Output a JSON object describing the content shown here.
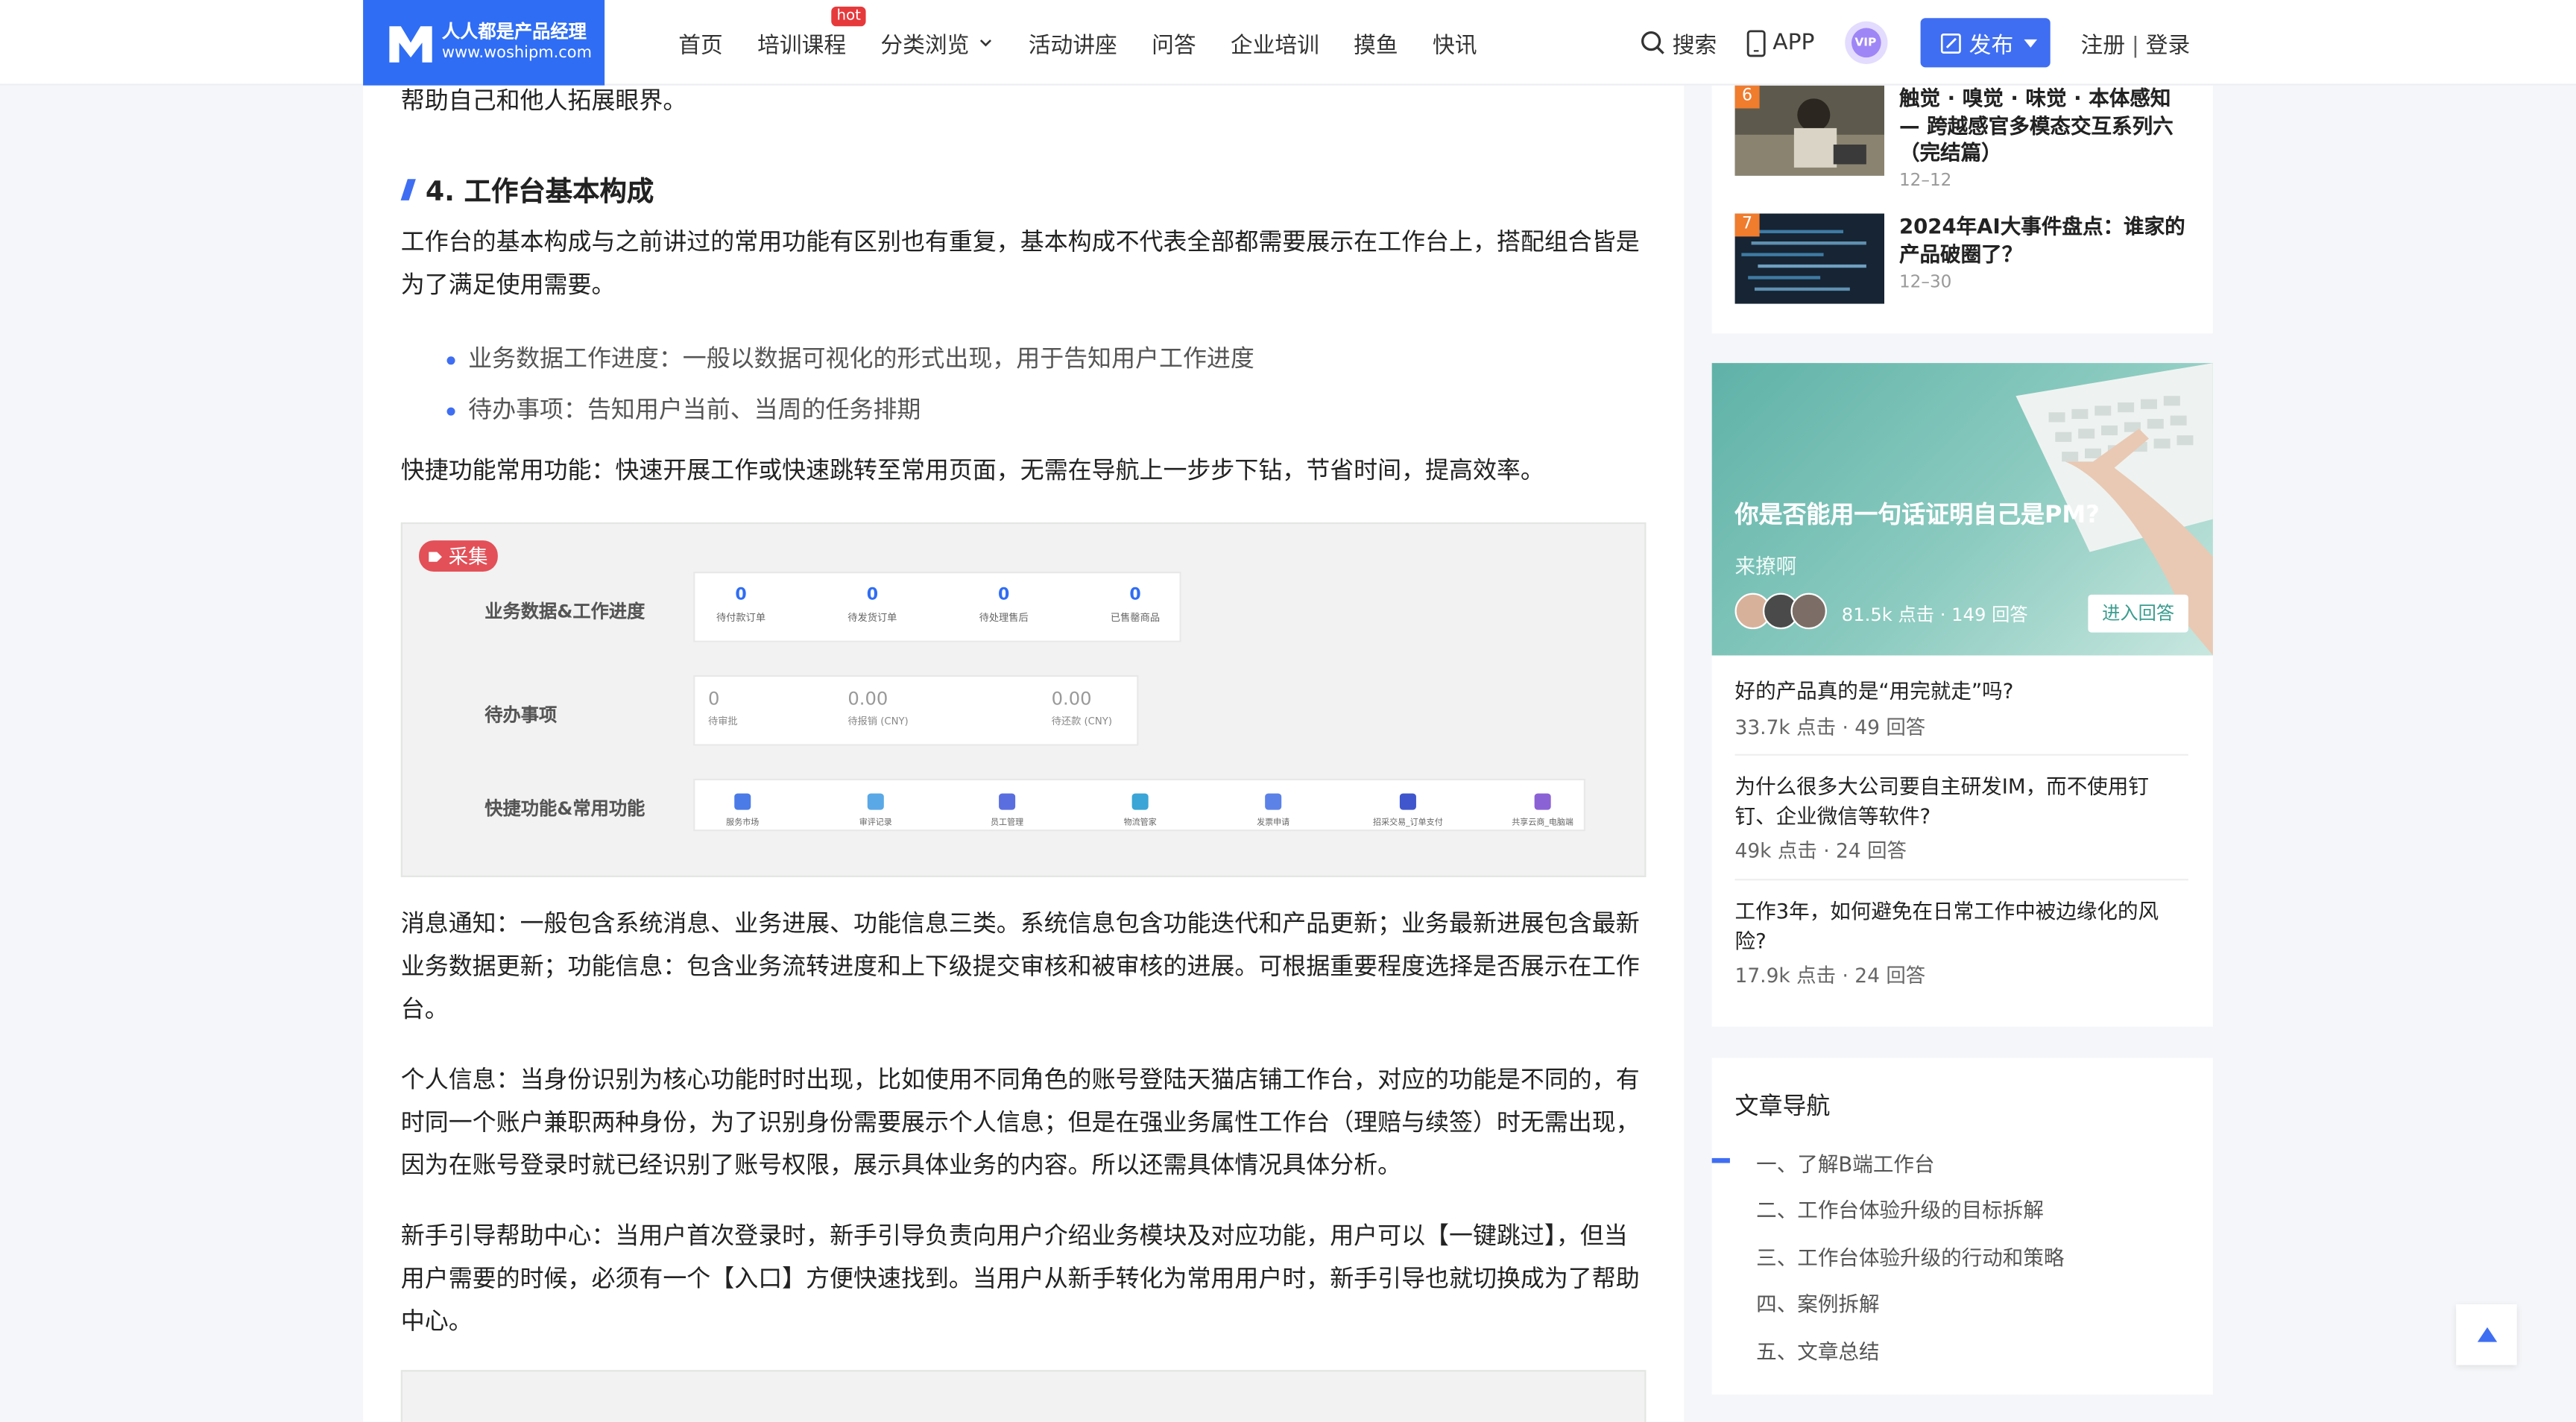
{
  "logo": {
    "line1": "人人都是产品经理",
    "line2": "www.woshipm.com"
  },
  "nav": {
    "items": [
      "首页",
      "培训课程",
      "分类浏览",
      "活动讲座",
      "问答",
      "企业培训",
      "摸鱼",
      "快讯"
    ],
    "hot_badge": "hot"
  },
  "header": {
    "search": "搜索",
    "app": "APP",
    "vip": "VIP",
    "publish": "发布",
    "register": "注册",
    "separator": "|",
    "login": "登录"
  },
  "article": {
    "p_top": "帮助自己和他人拓展眼界。",
    "section_title": "4. 工作台基本构成",
    "p1": "工作台的基本构成与之前讲过的常用功能有区别也有重复，基本构成不代表全部都需要展示在工作台上，搭配组合皆是为了满足使用需要。",
    "bullets": [
      "业务数据工作进度：一般以数据可视化的形式出现，用于告知用户工作进度",
      "待办事项：告知用户当前、当周的任务排期"
    ],
    "p2": "快捷功能常用功能：快速开展工作或快速跳转至常用页面，无需在导航上一步步下钻，节省时间，提高效率。",
    "p3": "消息通知：一般包含系统消息、业务进展、功能信息三类。系统信息包含功能迭代和产品更新；业务最新进展包含最新业务数据更新；功能信息：包含业务流转进度和上下级提交审核和被审核的进展。可根据重要程度选择是否展示在工作台。",
    "p4": "个人信息：当身份识别为核心功能时时出现，比如使用不同角色的账号登陆天猫店铺工作台，对应的功能是不同的，有时同一个账户兼职两种身份，为了识别身份需要展示个人信息；但是在强业务属性工作台（理赔与续签）时无需出现，因为在账号登录时就已经识别了账号权限，展示具体业务的内容。所以还需具体情况具体分析。",
    "p5": "新手引导帮助中心：当用户首次登录时，新手引导负责向用户介绍业务模块及对应功能，用户可以【一键跳过】，但当用户需要的时候，必须有一个【入口】方便快速找到。当用户从新手转化为常用用户时，新手引导也就切换成为了帮助中心。"
  },
  "figure": {
    "collect": "采集",
    "row1_label": "业务数据&工作进度",
    "row2_label": "待办事项",
    "row3_label": "快捷功能&常用功能",
    "stats": [
      {
        "n": "0",
        "t": "待付款订单"
      },
      {
        "n": "0",
        "t": "待发货订单"
      },
      {
        "n": "0",
        "t": "待处理售后"
      },
      {
        "n": "0",
        "t": "已售罄商品"
      }
    ],
    "todos": [
      {
        "n": "0",
        "t": "待审批"
      },
      {
        "n": "0.00",
        "t": "待报销 (CNY)"
      },
      {
        "n": "0.00",
        "t": "待还款 (CNY)"
      }
    ],
    "quick": [
      {
        "t": "服务市场",
        "c": "#4b7be6"
      },
      {
        "t": "审评记录",
        "c": "#5aa8e6"
      },
      {
        "t": "员工管理",
        "c": "#5b6ee0"
      },
      {
        "t": "物流管家",
        "c": "#3aa5d6"
      },
      {
        "t": "发票申请",
        "c": "#5c82e8"
      },
      {
        "t": "招采交易_订单支付",
        "c": "#3f56cc"
      },
      {
        "t": "共享云商_电脑端",
        "c": "#8a62d6"
      }
    ]
  },
  "sidebar": {
    "rank": [
      {
        "n": "6",
        "title": "触觉 · 嗅觉 · 味觉 · 本体感知 — 跨越感官多模态交互系列六（完结篇）",
        "date": "12–12"
      },
      {
        "n": "7",
        "title": "2024年AI大事件盘点：谁家的产品破圈了？",
        "date": "12–30"
      }
    ],
    "qa_banner": {
      "title": "你是否能用一句话证明自己是PM?",
      "sub": "来撩啊",
      "stats": "81.5k 点击 · 149 回答",
      "button": "进入回答"
    },
    "qa": [
      {
        "q": "好的产品真的是“用完就走”吗?",
        "m": "33.7k 点击 · 49 回答"
      },
      {
        "q": "为什么很多大公司要自主研发IM，而不使用钉钉、企业微信等软件?",
        "m": "49k 点击 · 24 回答"
      },
      {
        "q": "工作3年，如何避免在日常工作中被边缘化的风险?",
        "m": "17.9k 点击 · 24 回答"
      }
    ],
    "toc": {
      "title": "文章导航",
      "items": [
        "一、了解B端工作台",
        "二、工作台体验升级的目标拆解",
        "三、工作台体验升级的行动和策略",
        "四、案例拆解",
        "五、文章总结"
      ],
      "active": 0
    }
  },
  "colors": {
    "accent": "#3f6ef2",
    "logo_bg": "#2f6df4",
    "hot": "#e6393c",
    "rank_badge": "#f07c2e",
    "collect": "#e35058"
  }
}
